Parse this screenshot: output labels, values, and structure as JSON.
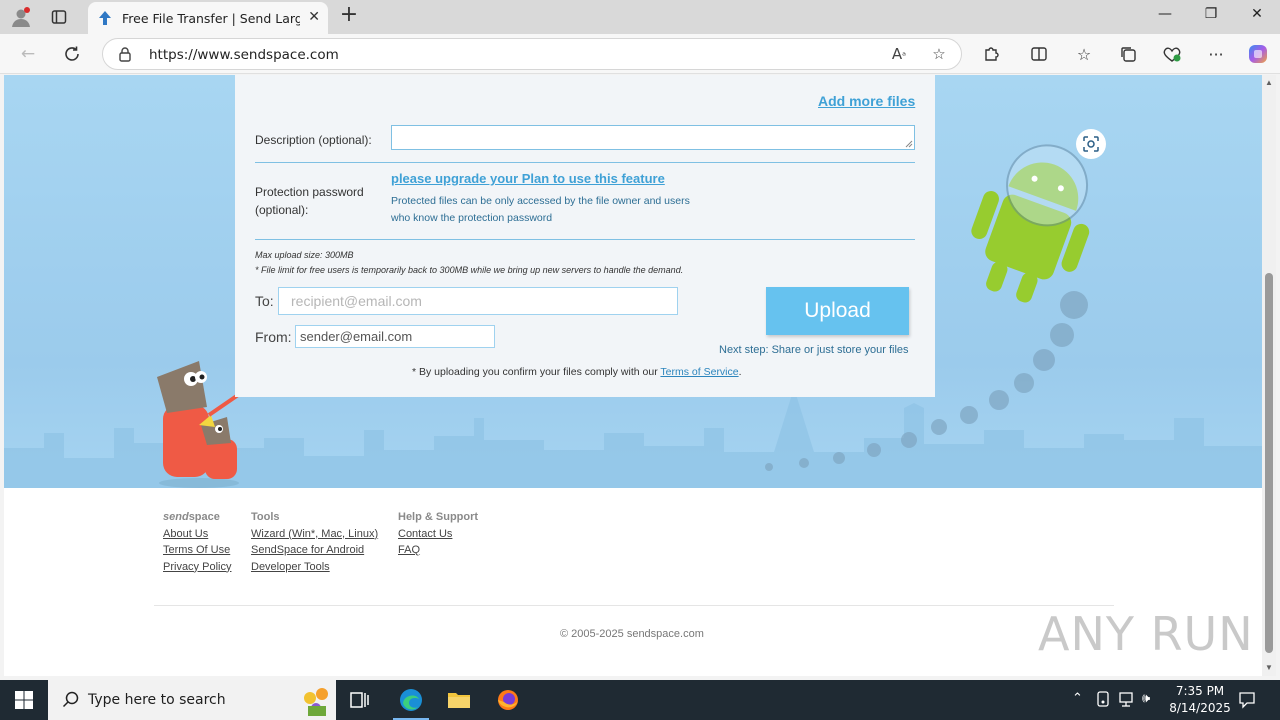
{
  "browser": {
    "tab_title": "Free File Transfer | Send Large File",
    "tab_close": "✕",
    "new_tab": "+",
    "url": "https://www.sendspace.com",
    "window_controls": {
      "minimize": "—",
      "restore": "❐",
      "close": "✕"
    }
  },
  "page": {
    "add_more_files": "Add more files",
    "description_label": "Description (optional):",
    "protection_label_line1": "Protection password",
    "protection_label_line2": "(optional):",
    "upgrade_link": "please upgrade your Plan to use this feature",
    "protection_note": "Protected files can be only accessed by the file owner and users who know the protection password",
    "max_upload": "Max upload size: 300MB",
    "limit_note": "* File limit for free users is temporarily back to 300MB while we bring up new servers to handle the demand.",
    "to_label": "To:",
    "to_placeholder": "recipient@email.com",
    "from_label": "From:",
    "from_value": "sender@email.com",
    "upload_button": "Upload",
    "next_step": "Next step: Share or just store your files",
    "tos_prefix": "* By uploading you confirm your files comply with our ",
    "tos_link": "Terms of Service",
    "tos_suffix": "."
  },
  "footer": {
    "brand_prefix": "send",
    "brand_suffix": "space",
    "brand_links": [
      "About Us",
      "Terms Of Use",
      "Privacy Policy"
    ],
    "tools_heading": "Tools",
    "tools_links": [
      "Wizard (Win*, Mac, Linux)",
      "SendSpace for Android",
      "Developer Tools"
    ],
    "help_heading": "Help & Support",
    "help_links": [
      "Contact Us",
      "FAQ"
    ],
    "copyright": "© 2005-2025 sendspace.com"
  },
  "watermark": "ANY RUN",
  "taskbar": {
    "search_placeholder": "Type here to search",
    "time": "7:35 PM",
    "date": "8/14/2025"
  },
  "colors": {
    "accent_link": "#3fa1d6",
    "upload_button": "#66c2ef",
    "hero_background": "#a8d6f2"
  }
}
